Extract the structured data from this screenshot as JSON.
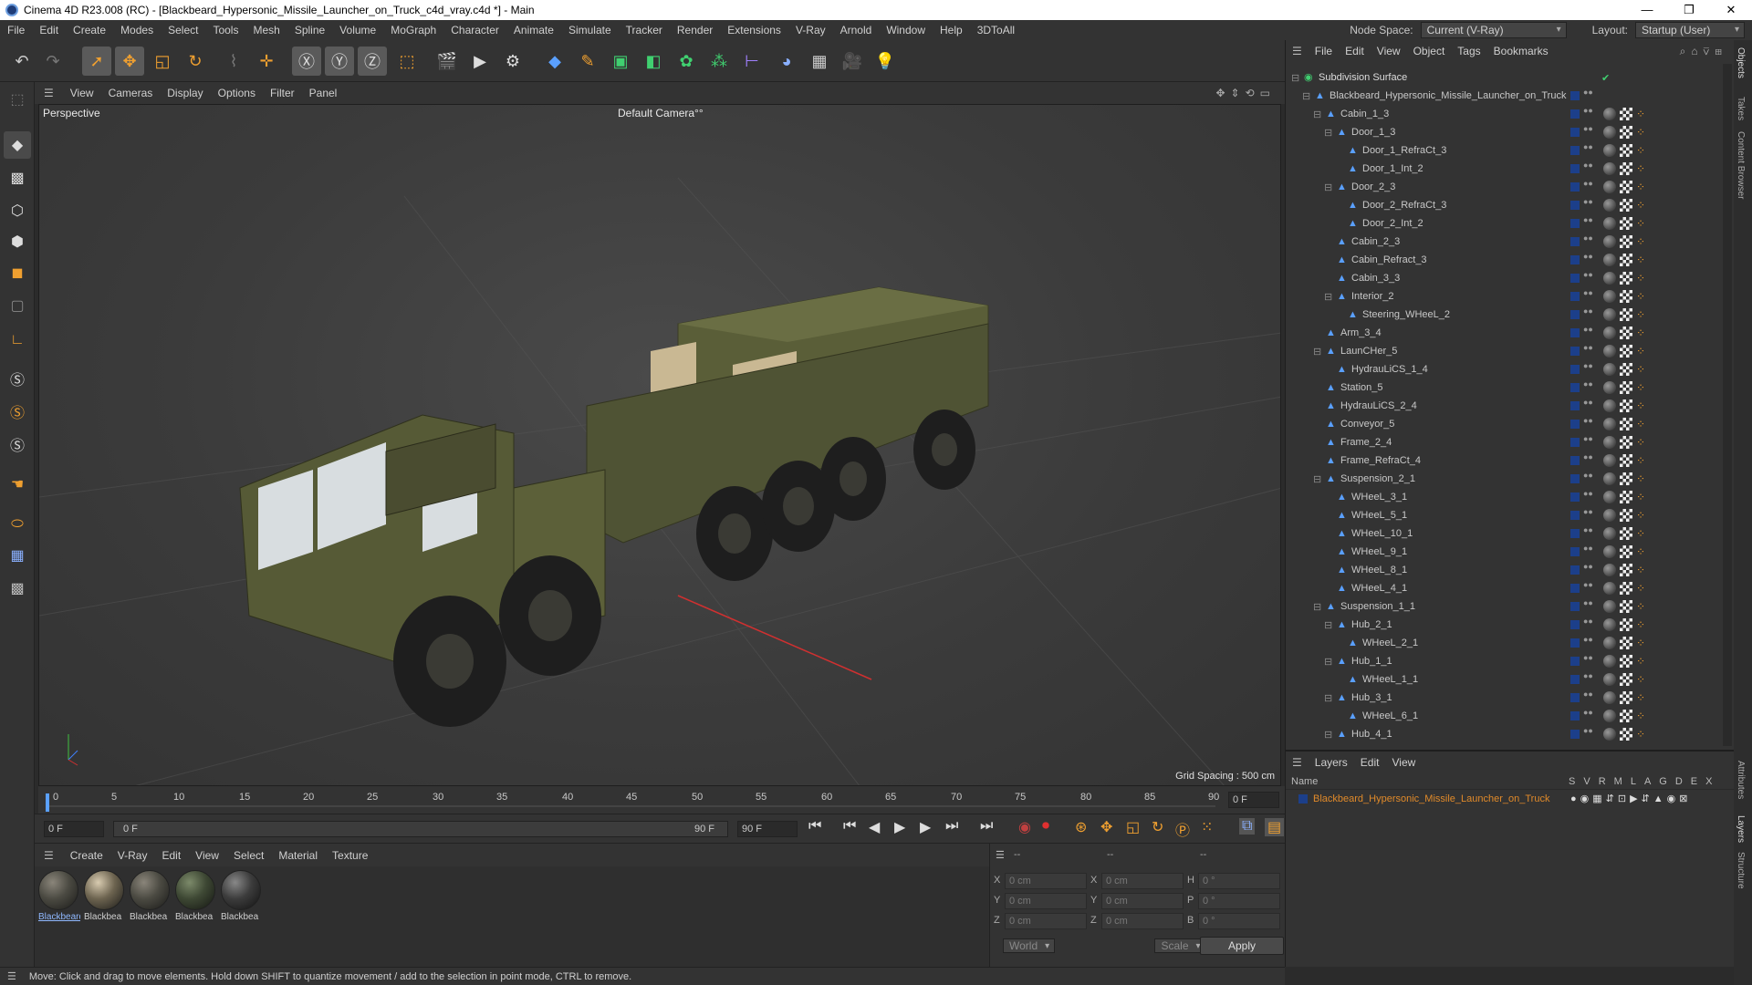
{
  "titlebar": {
    "title": "Cinema 4D R23.008 (RC) - [Blackbeard_Hypersonic_Missile_Launcher_on_Truck_c4d_vray.c4d *] - Main",
    "minimize": "—",
    "maximize": "❐",
    "close": "✕"
  },
  "menubar": {
    "items": [
      "File",
      "Edit",
      "Create",
      "Modes",
      "Select",
      "Tools",
      "Mesh",
      "Spline",
      "Volume",
      "MoGraph",
      "Character",
      "Animate",
      "Simulate",
      "Tracker",
      "Render",
      "Extensions",
      "V-Ray",
      "Arnold",
      "Window",
      "Help",
      "3DToAll"
    ],
    "node_space_label": "Node Space:",
    "node_space_value": "Current (V-Ray)",
    "layout_label": "Layout:",
    "layout_value": "Startup (User)"
  },
  "viewport_menu": {
    "items": [
      "View",
      "Cameras",
      "Display",
      "Options",
      "Filter",
      "Panel"
    ]
  },
  "viewport": {
    "label": "Perspective",
    "camera": "Default Camera",
    "camera_suffix": "°°",
    "grid_spacing": "Grid Spacing : 500 cm"
  },
  "timeline": {
    "ticks": [
      "0",
      "5",
      "10",
      "15",
      "20",
      "25",
      "30",
      "35",
      "40",
      "45",
      "50",
      "55",
      "60",
      "65",
      "70",
      "75",
      "80",
      "85",
      "90"
    ],
    "current_frame": "0 F"
  },
  "transport": {
    "start": "0 F",
    "range_start": "0 F",
    "range_end": "90 F",
    "end": "90 F"
  },
  "material_menu": {
    "items": [
      "Create",
      "V-Ray",
      "Edit",
      "View",
      "Select",
      "Material",
      "Texture"
    ]
  },
  "materials": [
    "Blackbeard",
    "Blackbea",
    "Blackbea",
    "Blackbea",
    "Blackbea"
  ],
  "coords": {
    "header_dashes": [
      "--",
      "--",
      "--"
    ],
    "x_label": "X",
    "y_label": "Y",
    "z_label": "Z",
    "h_label": "H",
    "p_label": "P",
    "b_label": "B",
    "pos_x": "0 cm",
    "pos_y": "0 cm",
    "pos_z": "0 cm",
    "size_x": "0 cm",
    "size_y": "0 cm",
    "size_z": "0 cm",
    "rot_h": "0 °",
    "rot_p": "0 °",
    "rot_b": "0 °",
    "world": "World",
    "scale": "Scale",
    "apply": "Apply"
  },
  "statusbar": {
    "text": "Move: Click and drag to move elements. Hold down SHIFT to quantize movement / add to the selection in point mode, CTRL to remove."
  },
  "object_menu": {
    "items": [
      "File",
      "Edit",
      "View",
      "Object",
      "Tags",
      "Bookmarks"
    ]
  },
  "objects": [
    {
      "name": "Subdivision Surface",
      "depth": 0,
      "expand": "⊟"
    },
    {
      "name": "Blackbeard_Hypersonic_Missile_Launcher_on_Truck",
      "depth": 1,
      "expand": "⊟"
    },
    {
      "name": "Cabin_1_3",
      "depth": 2,
      "expand": "⊟"
    },
    {
      "name": "Door_1_3",
      "depth": 3,
      "expand": "⊟"
    },
    {
      "name": "Door_1_RefraCt_3",
      "depth": 4,
      "expand": ""
    },
    {
      "name": "Door_1_Int_2",
      "depth": 4,
      "expand": ""
    },
    {
      "name": "Door_2_3",
      "depth": 3,
      "expand": "⊟"
    },
    {
      "name": "Door_2_RefraCt_3",
      "depth": 4,
      "expand": ""
    },
    {
      "name": "Door_2_Int_2",
      "depth": 4,
      "expand": ""
    },
    {
      "name": "Cabin_2_3",
      "depth": 3,
      "expand": ""
    },
    {
      "name": "Cabin_Refract_3",
      "depth": 3,
      "expand": ""
    },
    {
      "name": "Cabin_3_3",
      "depth": 3,
      "expand": ""
    },
    {
      "name": "Interior_2",
      "depth": 3,
      "expand": "⊟"
    },
    {
      "name": "Steering_WHeeL_2",
      "depth": 4,
      "expand": ""
    },
    {
      "name": "Arm_3_4",
      "depth": 2,
      "expand": ""
    },
    {
      "name": "LaunCHer_5",
      "depth": 2,
      "expand": "⊟"
    },
    {
      "name": "HydrauLiCS_1_4",
      "depth": 3,
      "expand": ""
    },
    {
      "name": "Station_5",
      "depth": 2,
      "expand": ""
    },
    {
      "name": "HydrauLiCS_2_4",
      "depth": 2,
      "expand": ""
    },
    {
      "name": "Conveyor_5",
      "depth": 2,
      "expand": ""
    },
    {
      "name": "Frame_2_4",
      "depth": 2,
      "expand": ""
    },
    {
      "name": "Frame_RefraCt_4",
      "depth": 2,
      "expand": ""
    },
    {
      "name": "Suspension_2_1",
      "depth": 2,
      "expand": "⊟"
    },
    {
      "name": "WHeeL_3_1",
      "depth": 3,
      "expand": ""
    },
    {
      "name": "WHeeL_5_1",
      "depth": 3,
      "expand": ""
    },
    {
      "name": "WHeeL_10_1",
      "depth": 3,
      "expand": ""
    },
    {
      "name": "WHeeL_9_1",
      "depth": 3,
      "expand": ""
    },
    {
      "name": "WHeeL_8_1",
      "depth": 3,
      "expand": ""
    },
    {
      "name": "WHeeL_4_1",
      "depth": 3,
      "expand": ""
    },
    {
      "name": "Suspension_1_1",
      "depth": 2,
      "expand": "⊟"
    },
    {
      "name": "Hub_2_1",
      "depth": 3,
      "expand": "⊟"
    },
    {
      "name": "WHeeL_2_1",
      "depth": 4,
      "expand": ""
    },
    {
      "name": "Hub_1_1",
      "depth": 3,
      "expand": "⊟"
    },
    {
      "name": "WHeeL_1_1",
      "depth": 4,
      "expand": ""
    },
    {
      "name": "Hub_3_1",
      "depth": 3,
      "expand": "⊟"
    },
    {
      "name": "WHeeL_6_1",
      "depth": 4,
      "expand": ""
    },
    {
      "name": "Hub_4_1",
      "depth": 3,
      "expand": "⊟"
    }
  ],
  "layer_menu": {
    "title": "Layers",
    "items": [
      "Edit",
      "View"
    ]
  },
  "layers": {
    "name_header": "Name",
    "flag_headers": [
      "S",
      "V",
      "R",
      "M",
      "L",
      "A",
      "G",
      "D",
      "E",
      "X"
    ],
    "row_name": "Blackbeard_Hypersonic_Missile_Launcher_on_Truck"
  },
  "side_tabs": [
    "Objects",
    "Takes",
    "Content Browser",
    "Attributes",
    "Layers",
    "Structure"
  ],
  "colors": {
    "accent": "#1c3f8a",
    "layer_text": "#e08a2a",
    "selection": "#5a5a5a"
  }
}
